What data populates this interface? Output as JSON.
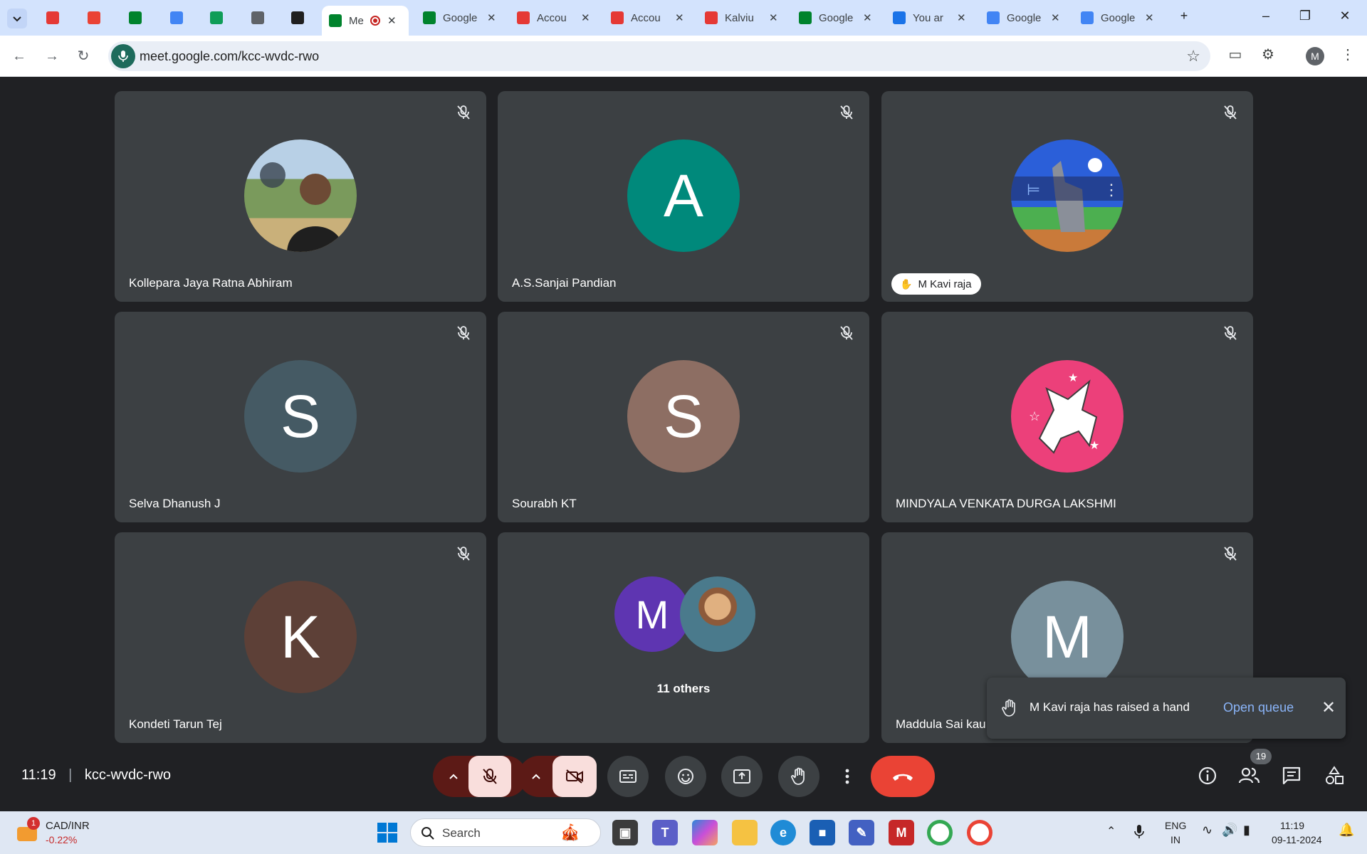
{
  "browser": {
    "tabs": [
      {
        "title": "",
        "icon": "kalvium-icon",
        "color": "#e53935"
      },
      {
        "title": "",
        "icon": "gmail-icon",
        "color": "#ea4335"
      },
      {
        "title": "",
        "icon": "google-meet-icon",
        "color": "#00832d"
      },
      {
        "title": "",
        "icon": "google-calendar-icon",
        "color": "#4285f4"
      },
      {
        "title": "",
        "icon": "google-sheets-icon",
        "color": "#0f9d58"
      },
      {
        "title": "",
        "icon": "globe-icon",
        "color": "#5f6368"
      },
      {
        "title": "",
        "icon": "github-icon",
        "color": "#1f1f1f"
      },
      {
        "title": "Me",
        "icon": "google-meet-icon",
        "color": "#00832d",
        "active": true
      },
      {
        "title": "Google",
        "icon": "google-meet-icon",
        "color": "#00832d"
      },
      {
        "title": "Accou",
        "icon": "kalvium-icon",
        "color": "#e53935"
      },
      {
        "title": "Accou",
        "icon": "kalvium-icon",
        "color": "#e53935"
      },
      {
        "title": "Kalviu",
        "icon": "kalvium-icon",
        "color": "#e53935"
      },
      {
        "title": "Google",
        "icon": "google-meet-icon",
        "color": "#00832d"
      },
      {
        "title": "You ar",
        "icon": "s-icon",
        "color": "#1a73e8"
      },
      {
        "title": "Google",
        "icon": "google-icon",
        "color": "#4285f4"
      },
      {
        "title": "Google",
        "icon": "google-icon",
        "color": "#4285f4"
      }
    ],
    "url": "meet.google.com/kcc-wvdc-rwo",
    "profile_initial": "M"
  },
  "meet": {
    "participants": [
      {
        "name": "Kollepara Jaya Ratna Abhiram",
        "initial": "",
        "avatar_color": "#6b8e5a",
        "photo": true
      },
      {
        "name": "A.S.Sanjai Pandian",
        "initial": "A",
        "avatar_color": "#00897b"
      },
      {
        "name": "M Kavi raja",
        "initial": "",
        "avatar_color": "#2b5fd9",
        "hand_raised": true
      },
      {
        "name": "Selva Dhanush J",
        "initial": "S",
        "avatar_color": "#455a64"
      },
      {
        "name": "Sourabh KT",
        "initial": "S",
        "avatar_color": "#8d6e63"
      },
      {
        "name": "MINDYALA VENKATA DURGA LAKSHMI",
        "initial": "",
        "avatar_color": "#ec407a"
      },
      {
        "name": "Kondeti Tarun Tej",
        "initial": "K",
        "avatar_color": "#5d4037"
      },
      {
        "name": "11 others",
        "initial": "M",
        "avatar_color": "#5e35b1"
      },
      {
        "name": "Maddula Sai kau",
        "initial": "M",
        "avatar_color": "#78909c"
      }
    ],
    "toast": {
      "message": "M Kavi raja has raised a hand",
      "action": "Open queue"
    },
    "time": "11:19",
    "meeting_code": "kcc-wvdc-rwo",
    "participant_count": "19"
  },
  "taskbar": {
    "ticker": "CAD/INR",
    "ticker_change": "-0.22%",
    "ticker_badge": "1",
    "search_placeholder": "Search",
    "lang": "ENG",
    "region": "IN",
    "clock_time": "11:19",
    "clock_date": "09-11-2024"
  }
}
